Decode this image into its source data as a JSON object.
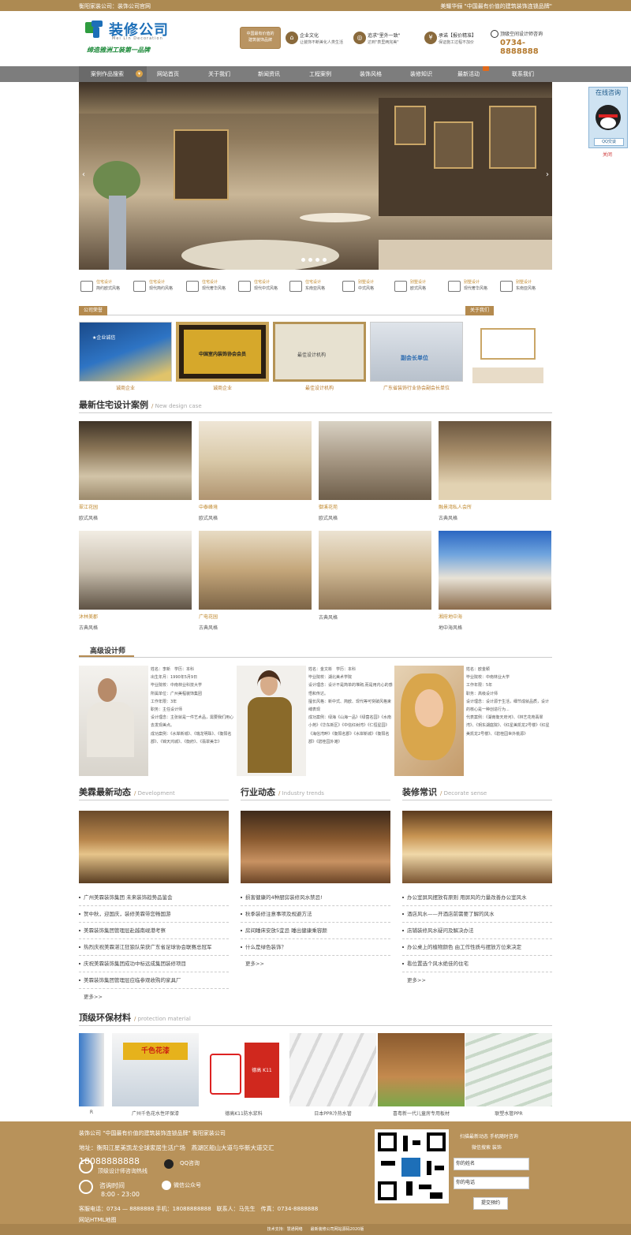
{
  "topbar": {
    "left": "衡阳家装公司：装饰公司官网",
    "right": "美耀华俪 \"中国最有价值的建筑装饰连锁品牌\""
  },
  "logo": {
    "name": "装修公司",
    "en": "Mei  Lin Decoration",
    "slogan": "缔造雅洲工装第一品牌"
  },
  "brand_box": {
    "line1": "中国最有价值的",
    "line2": "建筑装饰品牌"
  },
  "header_features": [
    {
      "icon": "home-icon",
      "title": "企业文化",
      "sub": "让装饰不断美化人类生活"
    },
    {
      "icon": "target-icon",
      "title": "追求\"里外一致\"",
      "sub": "达到\"表里两完美\""
    },
    {
      "icon": "quote-icon",
      "title": "承诺【报价精准】",
      "sub": "保证施工过程不加价"
    }
  ],
  "phone": {
    "label": "顶级空间设计师咨询",
    "number": "0734-8888888"
  },
  "nav": {
    "dropdown": "案例作品搜索",
    "items": [
      "网站首页",
      "关于我们",
      "新闻资讯",
      "工程案例",
      "装饰风格",
      "装修知识",
      "最新活动",
      "联系我们"
    ]
  },
  "styles": [
    {
      "t1": "住宅设计",
      "t2": "简约欧式风格"
    },
    {
      "t1": "住宅设计",
      "t2": "现代简约风格"
    },
    {
      "t1": "住宅设计",
      "t2": "现代奢华风格"
    },
    {
      "t1": "住宅设计",
      "t2": "现代中式风格"
    },
    {
      "t1": "住宅设计",
      "t2": "东南亚风格"
    },
    {
      "t1": "别墅设计",
      "t2": "中式风格"
    },
    {
      "t1": "别墅设计",
      "t2": "欧式风格"
    },
    {
      "t1": "别墅设计",
      "t2": "现代奢华风格"
    },
    {
      "t1": "别墅设计",
      "t2": "东南亚风格"
    }
  ],
  "honor": {
    "tag": "公司荣誉",
    "about_tag": "关于我们",
    "items": [
      {
        "caption": "诚商企业",
        "img_text": "★企业诚信"
      },
      {
        "caption": "诚商企业",
        "img_text": "中国室内装饰协会会员"
      },
      {
        "caption": "最佳设计机构",
        "img_text": "最佳设计机构"
      },
      {
        "caption": "广东省装饰行业协会副会长单位",
        "img_text": "副会长单位"
      }
    ]
  },
  "cases_section": {
    "title": "最新住宅设计案例",
    "en": "New design case"
  },
  "cases": [
    {
      "title": "翠江花园",
      "style": "欧式风格"
    },
    {
      "title": "中泰峰境",
      "style": "欧式风格"
    },
    {
      "title": "御溪花苑",
      "style": "欧式风格"
    },
    {
      "title": "融景湾私人会所",
      "style": "古典风格"
    },
    {
      "title": "沐林美郡",
      "style": "古典风格"
    },
    {
      "title": "广电花园",
      "style": "古典风格"
    },
    {
      "title": "",
      "style": "古典风格"
    },
    {
      "title": "湘府地中海",
      "style": "地中海风格"
    }
  ],
  "designers_section": {
    "title": "高级设计师"
  },
  "designers": [
    {
      "lines": [
        "姓名：李新　学历：本科",
        "出生年月：1990年5月9日",
        "毕业院校：中南林业科技大学",
        "所属单位：广州美程装饰集团",
        "工作年限：3年",
        "职务：主任设计师",
        "设计理念：主张就是一件艺术品，需要我们用心去发现美点。",
        "成功案例：《水岸新城》、《瑞龙明珠》、《衡阳名郡》、《锦天鸿城》、《衡府》、《翡翠美华》"
      ]
    },
    {
      "lines": [
        "姓名：金文彬　学历：本科",
        "毕业院校：湖北美术学院",
        "设计理念：设计不是简单的堆砌,而是用内心的感悟和传达。",
        "擅长风格：新中式、简欧、现代等可突破风格束缚表现",
        "成功案例：绿海《山海一品》《绿茵名园》《水南小苑》《华东新区》《中信红树湾》《仁恒星园》《海信湾畔》《衡阳名郡》《水岸新城》《衡阳名郡》《碧桂园外滩》"
      ]
    },
    {
      "lines": [
        "姓名：欧金颖",
        "毕业院校：中南林业大学",
        "工作年限：5年",
        "职务：高级设计师",
        "设计理念：设计源于生活，细节成就品质，设计的核心是一种创造行为...",
        "代表案例：《湖南衡天府河》、《林艺花苑翡翠湾》、《玥东湖庭院》、《红星美凯龙2号楼》《红星美凯龙2号楼》、《碧桂园世外桃源》"
      ]
    }
  ],
  "news": [
    {
      "title": "美霖最新动态",
      "en": "Development",
      "items": [
        "广州美霖装饰集团 未来装饰趋势品鉴会",
        "贺中秋，迎国庆，装修美霖带您畅国游",
        "美霖装饰集团管理层赴越南岘港考察",
        "热烈庆祝美霖湛江狂狼队荣获广东省足球协会联赛总冠军",
        "庆祝美霖装饰集团成功中标远成集团装修项目",
        "美霖装饰集团管理层应临参观收购的家具厂"
      ],
      "more": "更多>>"
    },
    {
      "title": "行业动态",
      "en": "Industry trends",
      "items": [
        "损害健康的4种厨房装修风水禁忌!",
        "秋季装修注意事项及规避方法",
        "房间睡床安放5宜忌 睡出健康乘容颜",
        "什么是绿色装饰？"
      ],
      "more": "更多>>"
    },
    {
      "title": "装修常识",
      "en": "Decorate sense",
      "items": [
        "办公室屏风摆放有原则 用屏风的力量改善办公室风水",
        "酒店风水——开酒店前需要了解的风水",
        "店铺装修风水疑问及解决办法",
        "办公桌上的植物颜色 由工作性质与摆放方位来决定",
        "看位置选个风水绝佳的住宅"
      ],
      "more": "更多>>"
    }
  ],
  "materials_section": {
    "title": "顶级环保材料",
    "en": "protection material"
  },
  "materials": [
    {
      "caption": "R"
    },
    {
      "caption": "广州千色花水性环保漆",
      "brand": "千色花漆"
    },
    {
      "caption": "德高K11防水浆料",
      "brand": "德高 K11"
    },
    {
      "caption": "日本PPR冷热水管"
    },
    {
      "caption": "喜粤新一代儿童房专用板材"
    },
    {
      "caption": "联塑水管PPR"
    }
  ],
  "footer": {
    "line1": "装饰公司 \"中国最有价值的建筑装饰连锁品牌\" 衡阳家装公司",
    "addr": "地址：衡阳江星美凯龙全球家居生活广场　燕湖区船山大道与华新大道交汇",
    "phone_big": "18088888888",
    "phone_label": "顶级设计师咨询热线",
    "qq": "QQ咨询",
    "time_label": "咨询时间",
    "time": "8:00 - 23:00",
    "wechat": "微信公众号",
    "contact": "客服电话：0734 — 8888888 手机：18088888888　联系人：马先生　传真：0734-8888888",
    "sitemap": "网站HTML地图",
    "scan1": "扫描最新动态 手机随时咨询",
    "scan2": "微信搜索 装饰",
    "name_placeholder": "你的姓名",
    "phone_placeholder": "你的电话",
    "submit": "提交预约",
    "copyright": "技术支持：慧通网络　　最新装修公司网站源码2020版"
  },
  "qqside": {
    "title": "在线咨询",
    "btn": "QQ交谈",
    "close": "关闭"
  }
}
